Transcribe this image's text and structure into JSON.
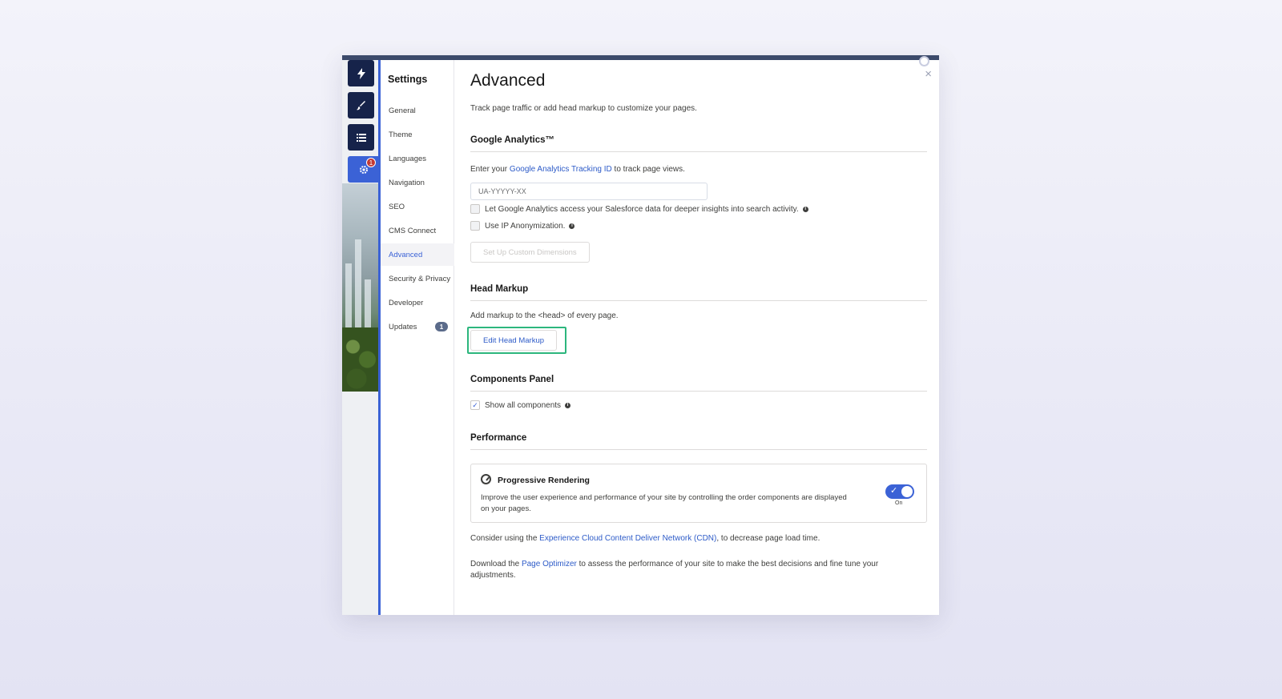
{
  "rail": {
    "icons": [
      "lightning-icon",
      "brush-icon",
      "list-icon",
      "gear-icon"
    ],
    "settings_badge": "1"
  },
  "nav": {
    "title": "Settings",
    "items": [
      {
        "label": "General"
      },
      {
        "label": "Theme"
      },
      {
        "label": "Languages"
      },
      {
        "label": "Navigation"
      },
      {
        "label": "SEO"
      },
      {
        "label": "CMS Connect"
      },
      {
        "label": "Advanced"
      },
      {
        "label": "Security & Privacy"
      },
      {
        "label": "Developer"
      },
      {
        "label": "Updates",
        "count": "1"
      }
    ],
    "active": "Advanced"
  },
  "main": {
    "close_glyph": "×",
    "title": "Advanced",
    "description": "Track page traffic or add head markup to customize your pages.",
    "analytics": {
      "heading": "Google Analytics™",
      "intro_before": "Enter your ",
      "intro_link": "Google Analytics Tracking ID",
      "intro_after": " to track page views.",
      "tracking_placeholder": "UA-YYYYY-XX",
      "checkbox_salesforce": "Let Google Analytics access your Salesforce data for deeper insights into search activity.",
      "checkbox_ip": "Use IP Anonymization.",
      "custom_dimensions_button": "Set Up Custom Dimensions"
    },
    "head_markup": {
      "heading": "Head Markup",
      "text": "Add markup to the <head> of every page.",
      "edit_button": "Edit Head Markup"
    },
    "components": {
      "heading": "Components Panel",
      "show_all": "Show all components",
      "show_all_checked": true
    },
    "performance": {
      "heading": "Performance",
      "card_title": "Progressive Rendering",
      "card_desc": "Improve the user experience and performance of your site by controlling the order components are displayed on your pages.",
      "toggle_state": "On",
      "cdn_before": "Consider using the ",
      "cdn_link": "Experience Cloud Content Deliver Network (CDN)",
      "cdn_after": ", to decrease page load time.",
      "optimizer_before": "Download the ",
      "optimizer_link": "Page Optimizer",
      "optimizer_after": " to assess the performance of your site to make the best decisions and fine tune your adjustments."
    }
  },
  "colors": {
    "accent": "#3b62d6",
    "rail_dark": "#16234a",
    "highlight": "#2cb67d",
    "link": "#2d5bc8"
  }
}
